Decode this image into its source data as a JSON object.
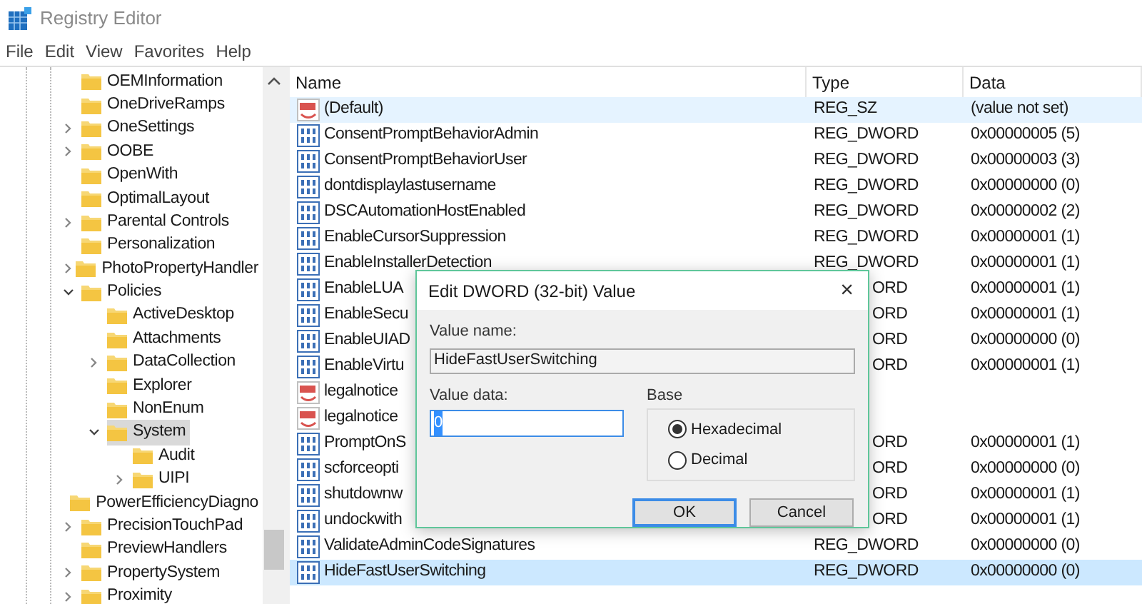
{
  "window": {
    "title": "Registry Editor"
  },
  "menu": [
    "File",
    "Edit",
    "View",
    "Favorites",
    "Help"
  ],
  "tree": [
    {
      "label": "OEMInformation",
      "selected": false
    },
    {
      "label": "OneDriveRamps",
      "selected": false
    },
    {
      "label": "OneSettings",
      "expanded": false,
      "selected": false
    },
    {
      "label": "OOBE",
      "expanded": false,
      "selected": false
    },
    {
      "label": "OpenWith",
      "selected": false
    },
    {
      "label": "OptimalLayout",
      "selected": false
    },
    {
      "label": "Parental Controls",
      "expanded": false,
      "selected": false
    },
    {
      "label": "Personalization",
      "selected": false
    },
    {
      "label": "PhotoPropertyHandler",
      "expanded": false,
      "selected": false
    },
    {
      "label": "Policies",
      "expanded": true,
      "selected": false,
      "children": [
        {
          "label": "ActiveDesktop",
          "selected": false
        },
        {
          "label": "Attachments",
          "selected": false
        },
        {
          "label": "DataCollection",
          "expanded": false,
          "selected": false
        },
        {
          "label": "Explorer",
          "selected": false
        },
        {
          "label": "NonEnum",
          "selected": false
        },
        {
          "label": "System",
          "expanded": true,
          "selected": true,
          "children": [
            {
              "label": "Audit",
              "selected": false
            },
            {
              "label": "UIPI",
              "expanded": false,
              "selected": false
            }
          ]
        }
      ]
    },
    {
      "label": "PowerEfficiencyDiagno",
      "selected": false
    },
    {
      "label": "PrecisionTouchPad",
      "expanded": false,
      "selected": false
    },
    {
      "label": "PreviewHandlers",
      "selected": false
    },
    {
      "label": "PropertySystem",
      "expanded": false,
      "selected": false
    },
    {
      "label": "Proximity",
      "expanded": false,
      "selected": false
    }
  ],
  "table": {
    "columns": [
      "Name",
      "Type",
      "Data"
    ],
    "rows": [
      {
        "kind": "string",
        "name": "(Default)",
        "type": "REG_SZ",
        "data": "(value not set)",
        "selected": false,
        "hovered": true,
        "covered": false
      },
      {
        "kind": "dword",
        "name": "ConsentPromptBehaviorAdmin",
        "type": "REG_DWORD",
        "data": "0x00000005 (5)",
        "selected": false,
        "hovered": false,
        "covered": false
      },
      {
        "kind": "dword",
        "name": "ConsentPromptBehaviorUser",
        "type": "REG_DWORD",
        "data": "0x00000003 (3)",
        "selected": false,
        "hovered": false,
        "covered": false
      },
      {
        "kind": "dword",
        "name": "dontdisplaylastusername",
        "type": "REG_DWORD",
        "data": "0x00000000 (0)",
        "selected": false,
        "hovered": false,
        "covered": false
      },
      {
        "kind": "dword",
        "name": "DSCAutomationHostEnabled",
        "type": "REG_DWORD",
        "data": "0x00000002 (2)",
        "selected": false,
        "hovered": false,
        "covered": false
      },
      {
        "kind": "dword",
        "name": "EnableCursorSuppression",
        "type": "REG_DWORD",
        "data": "0x00000001 (1)",
        "selected": false,
        "hovered": false,
        "covered": false
      },
      {
        "kind": "dword",
        "name": "EnableInstallerDetection",
        "type": "REG_DWORD",
        "data": "0x00000001 (1)",
        "selected": false,
        "hovered": false,
        "covered": false
      },
      {
        "kind": "dword",
        "name": "EnableLUA",
        "type": "ORD",
        "data": "0x00000001 (1)",
        "selected": false,
        "hovered": false,
        "covered": true
      },
      {
        "kind": "dword",
        "name": "EnableSecu",
        "type": "ORD",
        "data": "0x00000001 (1)",
        "selected": false,
        "hovered": false,
        "covered": true
      },
      {
        "kind": "dword",
        "name": "EnableUIAD",
        "type": "ORD",
        "data": "0x00000000 (0)",
        "selected": false,
        "hovered": false,
        "covered": true
      },
      {
        "kind": "dword",
        "name": "EnableVirtu",
        "type": "ORD",
        "data": "0x00000001 (1)",
        "selected": false,
        "hovered": false,
        "covered": true
      },
      {
        "kind": "string",
        "name": "legalnotice",
        "selected": false,
        "hovered": false
      },
      {
        "kind": "string",
        "name": "legalnotice",
        "selected": false,
        "hovered": false
      },
      {
        "kind": "dword",
        "name": "PromptOnS",
        "type": "ORD",
        "data": "0x00000001 (1)",
        "selected": false,
        "hovered": false,
        "covered": true
      },
      {
        "kind": "dword",
        "name": "scforceopti",
        "type": "ORD",
        "data": "0x00000000 (0)",
        "selected": false,
        "hovered": false,
        "covered": true
      },
      {
        "kind": "dword",
        "name": "shutdownw",
        "type": "ORD",
        "data": "0x00000001 (1)",
        "selected": false,
        "hovered": false,
        "covered": true
      },
      {
        "kind": "dword",
        "name": "undockwith",
        "type": "ORD",
        "data": "0x00000001 (1)",
        "selected": false,
        "hovered": false,
        "covered": true
      },
      {
        "kind": "dword",
        "name": "ValidateAdminCodeSignatures",
        "type": "REG_DWORD",
        "data": "0x00000000 (0)",
        "selected": false,
        "hovered": false,
        "covered": false
      },
      {
        "kind": "dword",
        "name": "HideFastUserSwitching",
        "type": "REG_DWORD",
        "data": "0x00000000 (0)",
        "selected": true,
        "hovered": false,
        "covered": false
      }
    ]
  },
  "dialog": {
    "title": "Edit DWORD (32-bit) Value",
    "close": "×",
    "name_label": "Value name:",
    "name_value": "HideFastUserSwitching",
    "data_label": "Value data:",
    "data_value": "0",
    "base_label": "Base",
    "radios": [
      {
        "label": "Hexadecimal",
        "selected": true
      },
      {
        "label": "Decimal",
        "selected": false
      }
    ],
    "buttons": [
      {
        "label": "OK",
        "focused": true
      },
      {
        "label": "Cancel",
        "focused": false
      }
    ]
  }
}
